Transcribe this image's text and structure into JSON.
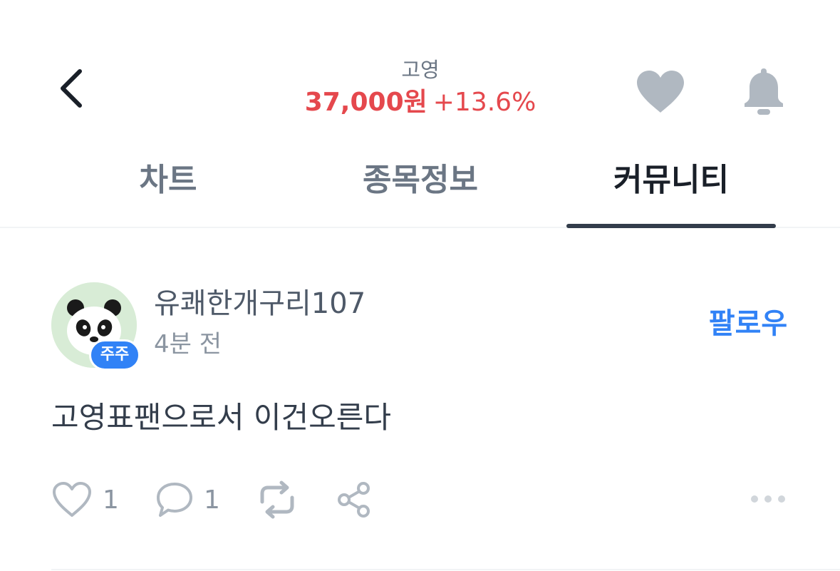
{
  "header": {
    "stock_name": "고영",
    "price": "37,000원",
    "change": "+13.6%",
    "back_icon": "chevron-left-icon",
    "favorite_icon": "heart-icon",
    "alert_icon": "bell-icon"
  },
  "tabs": [
    {
      "label": "차트",
      "active": false
    },
    {
      "label": "종목정보",
      "active": false
    },
    {
      "label": "커뮤니티",
      "active": true
    }
  ],
  "post": {
    "author": "유쾌한개구리107",
    "badge": "주주",
    "time": "4분 전",
    "follow_label": "팔로우",
    "body": "고영표팬으로서 이건오른다",
    "likes": "1",
    "comments": "1"
  },
  "colors": {
    "price_up": "#e5484d",
    "accent": "#3182f6",
    "icon_gray": "#b0b8c1",
    "text_dark": "#191f28",
    "text_gray": "#6b7684"
  }
}
